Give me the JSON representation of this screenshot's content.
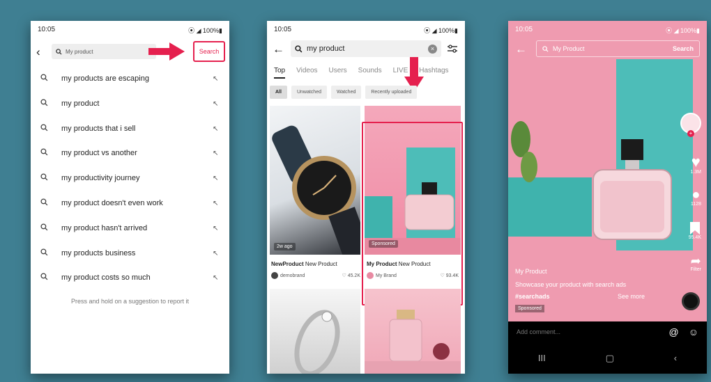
{
  "phone1": {
    "time": "10:05",
    "status_right": "⦿ ◢ 100%▮",
    "back_icon": "‹",
    "search_text": "My product",
    "search_button": "Search",
    "suggestions": [
      "my products are escaping",
      "my product",
      "my products that i sell",
      "my product vs another",
      "my productivity journey",
      "my product doesn't even work",
      "my product hasn't arrived",
      "my products business",
      "my product costs so much"
    ],
    "hint": "Press and hold on a suggestion to report it"
  },
  "phone2": {
    "time": "10:05",
    "status_right": "⦿ ◢ 100%▮",
    "search_text": "my product",
    "tabs": [
      "Top",
      "Videos",
      "Users",
      "Sounds",
      "LIVE",
      "Hashtags"
    ],
    "filters": [
      "All",
      "Unwatched",
      "Watched",
      "Recently uploaded"
    ],
    "tiles": [
      {
        "badge": "2w ago",
        "title": "NewProduct",
        "subtitle": "New Product",
        "author": "demobrand",
        "likes": "♡ 45.2K"
      },
      {
        "badge": "Sponsored",
        "title": "My Product",
        "subtitle": "New Product",
        "author": "My Brand",
        "likes": "♡ 93.4K"
      }
    ]
  },
  "phone3": {
    "time": "10:05",
    "status_right": "⦿ ◢ 100%▮",
    "search_text": "My Product",
    "search_button": "Search",
    "counts": {
      "likes": "1.3M",
      "comments": "1128",
      "saves": "95.4K",
      "shares": "Filter"
    },
    "account": "My Product",
    "caption": "Showcase your product with search ads",
    "hashtag": "#searchads",
    "see_more": "See more",
    "sponsored": "Sponsored",
    "comment_placeholder": "Add comment...",
    "nav": [
      "III",
      "▢",
      "‹"
    ]
  },
  "colors": {
    "accent": "#e5204e",
    "background": "#3f7f92",
    "teal": "#4dbdb8",
    "pink": "#f08aa4"
  }
}
